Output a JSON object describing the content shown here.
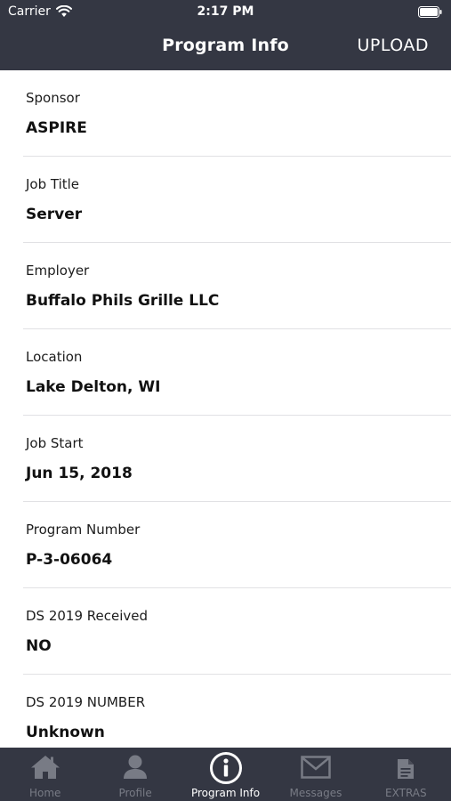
{
  "status_bar": {
    "carrier": "Carrier",
    "time": "2:17 PM"
  },
  "nav": {
    "title": "Program Info",
    "upload_label": "UPLOAD"
  },
  "fields": [
    {
      "label": "Sponsor",
      "value": "ASPIRE"
    },
    {
      "label": "Job Title",
      "value": "Server"
    },
    {
      "label": "Employer",
      "value": "Buffalo Phils Grille LLC"
    },
    {
      "label": "Location",
      "value": "Lake Delton, WI"
    },
    {
      "label": "Job Start",
      "value": "Jun 15, 2018"
    },
    {
      "label": "Program Number",
      "value": "P-3-06064"
    },
    {
      "label": "DS 2019 Received",
      "value": "NO"
    },
    {
      "label": "DS 2019 NUMBER",
      "value": "Unknown"
    }
  ],
  "tabs": [
    {
      "label": "Home",
      "icon": "home-icon",
      "active": false
    },
    {
      "label": "Profile",
      "icon": "person-icon",
      "active": false
    },
    {
      "label": "Program Info",
      "icon": "info-icon",
      "active": true
    },
    {
      "label": "Messages",
      "icon": "envelope-icon",
      "active": false
    },
    {
      "label": "EXTRAS",
      "icon": "document-icon",
      "active": false
    }
  ],
  "colors": {
    "bar_background": "#343743",
    "tab_active": "#ffffff",
    "tab_inactive": "#787b85",
    "separator": "#e1e1e4"
  }
}
